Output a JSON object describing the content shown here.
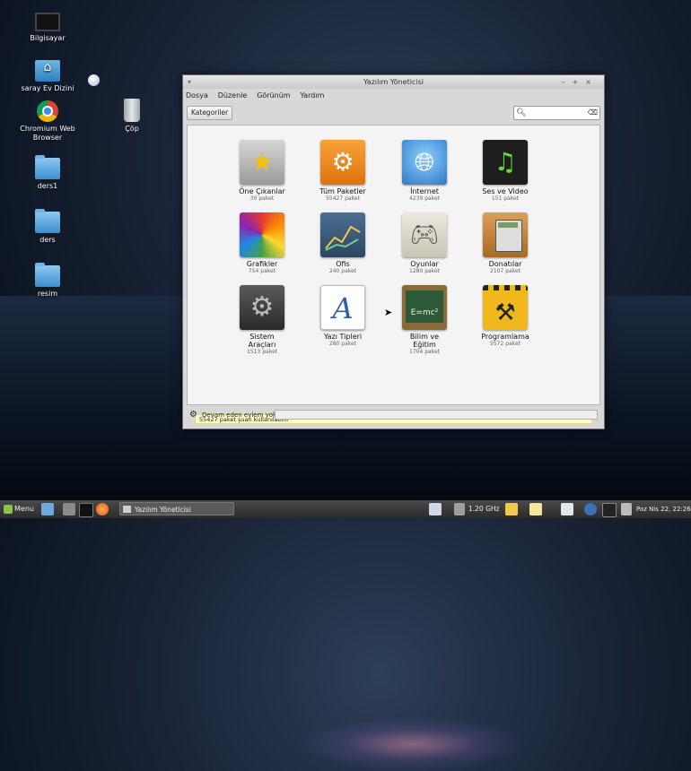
{
  "desktop": {
    "icons": [
      {
        "label": "Bilgisayar",
        "icon": "computer-icon"
      },
      {
        "label": "saray Ev Dizini",
        "icon": "home-folder-icon"
      },
      {
        "label": "Chromium Web Browser",
        "icon": "chromium-icon"
      },
      {
        "label": "Çöp",
        "icon": "trash-icon"
      },
      {
        "label": "ders1",
        "icon": "folder-icon"
      },
      {
        "label": "ders",
        "icon": "folder-icon"
      },
      {
        "label": "resim",
        "icon": "folder-icon"
      }
    ]
  },
  "window": {
    "title": "Yazılım Yöneticisi",
    "controls": [
      "–",
      "+",
      "×"
    ],
    "menu": [
      "Dosya",
      "Düzenle",
      "Görünüm",
      "Yardım"
    ],
    "toolbar": {
      "categories_button": "Kategoriler",
      "search_placeholder": ""
    },
    "categories": [
      {
        "name": "Öne Çıkanlar",
        "count": "30 paket",
        "icon": "star-icon",
        "color": "#b9b9b9"
      },
      {
        "name": "Tüm Paketler",
        "count": "55427 paket",
        "icon": "gears-icon",
        "color": "#f08a1c"
      },
      {
        "name": "İnternet",
        "count": "4239 paket",
        "icon": "globe-icon",
        "color": "#3f8fd8"
      },
      {
        "name": "Ses ve Video",
        "count": "151 paket",
        "icon": "music-icon",
        "color": "#2a2a2a"
      },
      {
        "name": "Grafikler",
        "count": "754 paket",
        "icon": "color-wheel-icon",
        "color": "#e04f9a"
      },
      {
        "name": "Ofis",
        "count": "240 paket",
        "icon": "chart-icon",
        "color": "#3a5a7a"
      },
      {
        "name": "Oyunlar",
        "count": "1280 paket",
        "icon": "gamepad-icon",
        "color": "#d9d5c8"
      },
      {
        "name": "Donatılar",
        "count": "2107 paket",
        "icon": "calculator-icon",
        "color": "#c8893a"
      },
      {
        "name": "Sistem Araçları",
        "count": "1513 paket",
        "icon": "system-gears-icon",
        "color": "#444444"
      },
      {
        "name": "Yazı Tipleri",
        "count": "280 paket",
        "icon": "font-icon",
        "color": "#ffffff"
      },
      {
        "name": "Bilim ve Eğitim",
        "count": "1704 paket",
        "icon": "chalkboard-icon",
        "color": "#2e5a3a"
      },
      {
        "name": "Programlama",
        "count": "5572 paket",
        "icon": "construction-icon",
        "color": "#f0b81c"
      }
    ],
    "chalkboard_text": "E=mc²",
    "font_glyph": "A",
    "status_message": "55427 paket şuan kullanılabilir",
    "bottom_status": "Devam eden eylem yok"
  },
  "panel": {
    "menu_label": "Menu",
    "task_label": "Yazılım Yöneticisi",
    "cpu": "1.20 GHz",
    "clock": "Paz Nis 22, 22:26"
  }
}
